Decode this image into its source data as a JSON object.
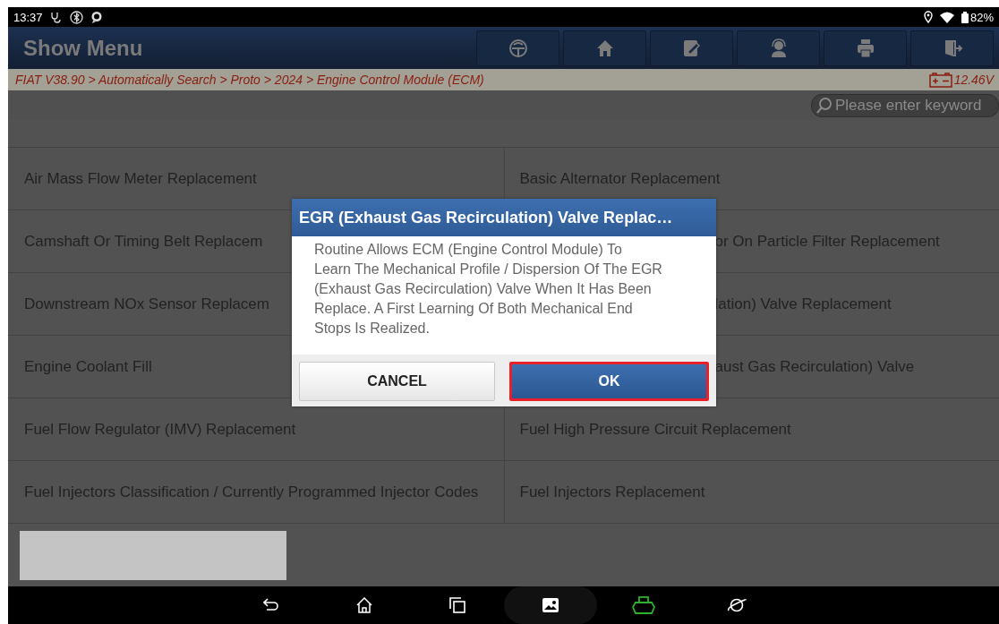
{
  "status_bar": {
    "time": "13:37",
    "battery": "82%"
  },
  "header": {
    "title": "Show Menu"
  },
  "breadcrumb": {
    "path": "FIAT V38.90 > Automatically Search > Proto > 2024 > Engine Control Module (ECM)",
    "voltage": "12.46V"
  },
  "search": {
    "placeholder": "Please enter keyword"
  },
  "menu": {
    "rows": [
      [
        "Air Mass Flow Meter Replacement",
        "Basic Alternator Replacement"
      ],
      [
        "Camshaft Or Timing Belt Replacem",
        "or On Particle Filter Replacement"
      ],
      [
        "Downstream NOx Sensor Replacem",
        "lation) Valve Replacement"
      ],
      [
        "Engine Coolant Fill",
        "aust Gas Recirculation) Valve"
      ],
      [
        "Fuel Flow Regulator (IMV) Replacement",
        "Fuel High Pressure Circuit Replacement"
      ],
      [
        "Fuel Injectors Classification / Currently Programmed Injector Codes",
        "Fuel Injectors Replacement"
      ]
    ]
  },
  "dialog": {
    "title": "EGR (Exhaust Gas Recirculation) Valve Replac…",
    "message": "Routine Allows ECM (Engine Control Module) To Learn The Mechanical Profile / Dispersion Of The EGR (Exhaust Gas Recirculation) Valve When It Has Been Replace. A First Learning Of Both Mechanical End Stops Is Realized.",
    "buttons": [
      {
        "label": "CANCEL",
        "kind": "secondary",
        "selected": false
      },
      {
        "label": "OK",
        "kind": "primary",
        "selected": true
      }
    ]
  }
}
